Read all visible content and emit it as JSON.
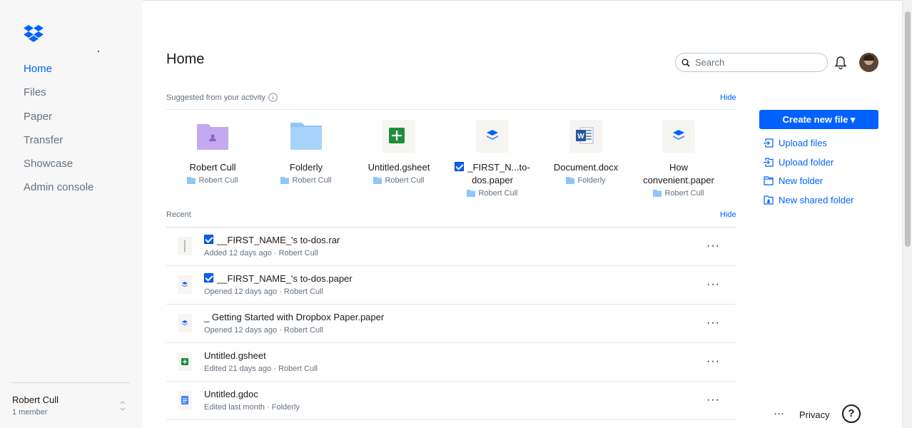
{
  "sidebar": {
    "logo": "dropbox-logo",
    "nav": [
      {
        "label": "Home",
        "active": true
      },
      {
        "label": "Files"
      },
      {
        "label": "Paper"
      },
      {
        "label": "Transfer"
      },
      {
        "label": "Showcase"
      },
      {
        "label": "Admin console"
      }
    ],
    "team": {
      "name": "Robert Cull",
      "members": "1 member"
    }
  },
  "header": {
    "title": "Home",
    "search_placeholder": "Search"
  },
  "suggested": {
    "label": "Suggested from your activity",
    "hide": "Hide",
    "items": [
      {
        "name": "Robert Cull",
        "location": "Robert Cull",
        "icon": "shared-folder-icon"
      },
      {
        "name": "Folderly",
        "location": "Robert Cull",
        "icon": "folder-icon"
      },
      {
        "name": "Untitled.gsheet",
        "location": "Robert Cull",
        "icon": "gsheet-icon"
      },
      {
        "name_line1": "_FIRST_N...to-",
        "name_line2": "dos.paper",
        "location": "Robert Cull",
        "icon": "paper-icon",
        "checked": true
      },
      {
        "name": "Document.docx",
        "location": "Folderly",
        "icon": "word-icon"
      },
      {
        "name_line1": "How",
        "name_line2": "convenient.paper",
        "location": "Robert Cull",
        "icon": "paper-icon"
      }
    ]
  },
  "recent": {
    "label": "Recent",
    "hide": "Hide",
    "items": [
      {
        "name": "__FIRST_NAME_'s to-dos.rar",
        "meta": "Added 12 days ago · Robert Cull",
        "icon": "archive-icon",
        "checked": true
      },
      {
        "name": "__FIRST_NAME_'s to-dos.paper",
        "meta": "Opened 12 days ago · Robert Cull",
        "icon": "paper-icon",
        "checked": true
      },
      {
        "name": "_ Getting Started with Dropbox Paper.paper",
        "meta": "Opened 12 days ago · Robert Cull",
        "icon": "paper-icon"
      },
      {
        "name": "Untitled.gsheet",
        "meta": "Edited 21 days ago · Robert Cull",
        "icon": "gsheet-icon"
      },
      {
        "name": "Untitled.gdoc",
        "meta": "Edited last month · Folderly",
        "icon": "gdoc-icon"
      }
    ],
    "more": "···"
  },
  "actions": {
    "create": "Create new file ▾",
    "upload_files": "Upload files",
    "upload_folder": "Upload folder",
    "new_folder": "New folder",
    "new_shared_folder": "New shared folder"
  },
  "footer": {
    "more": "···",
    "privacy": "Privacy",
    "help": "?"
  },
  "colors": {
    "accent": "#0061fe",
    "folder": "#8fc6f8",
    "shared_folder": "#c3a9ef",
    "sheet": "#1e8e3e",
    "word": "#2b579a"
  }
}
